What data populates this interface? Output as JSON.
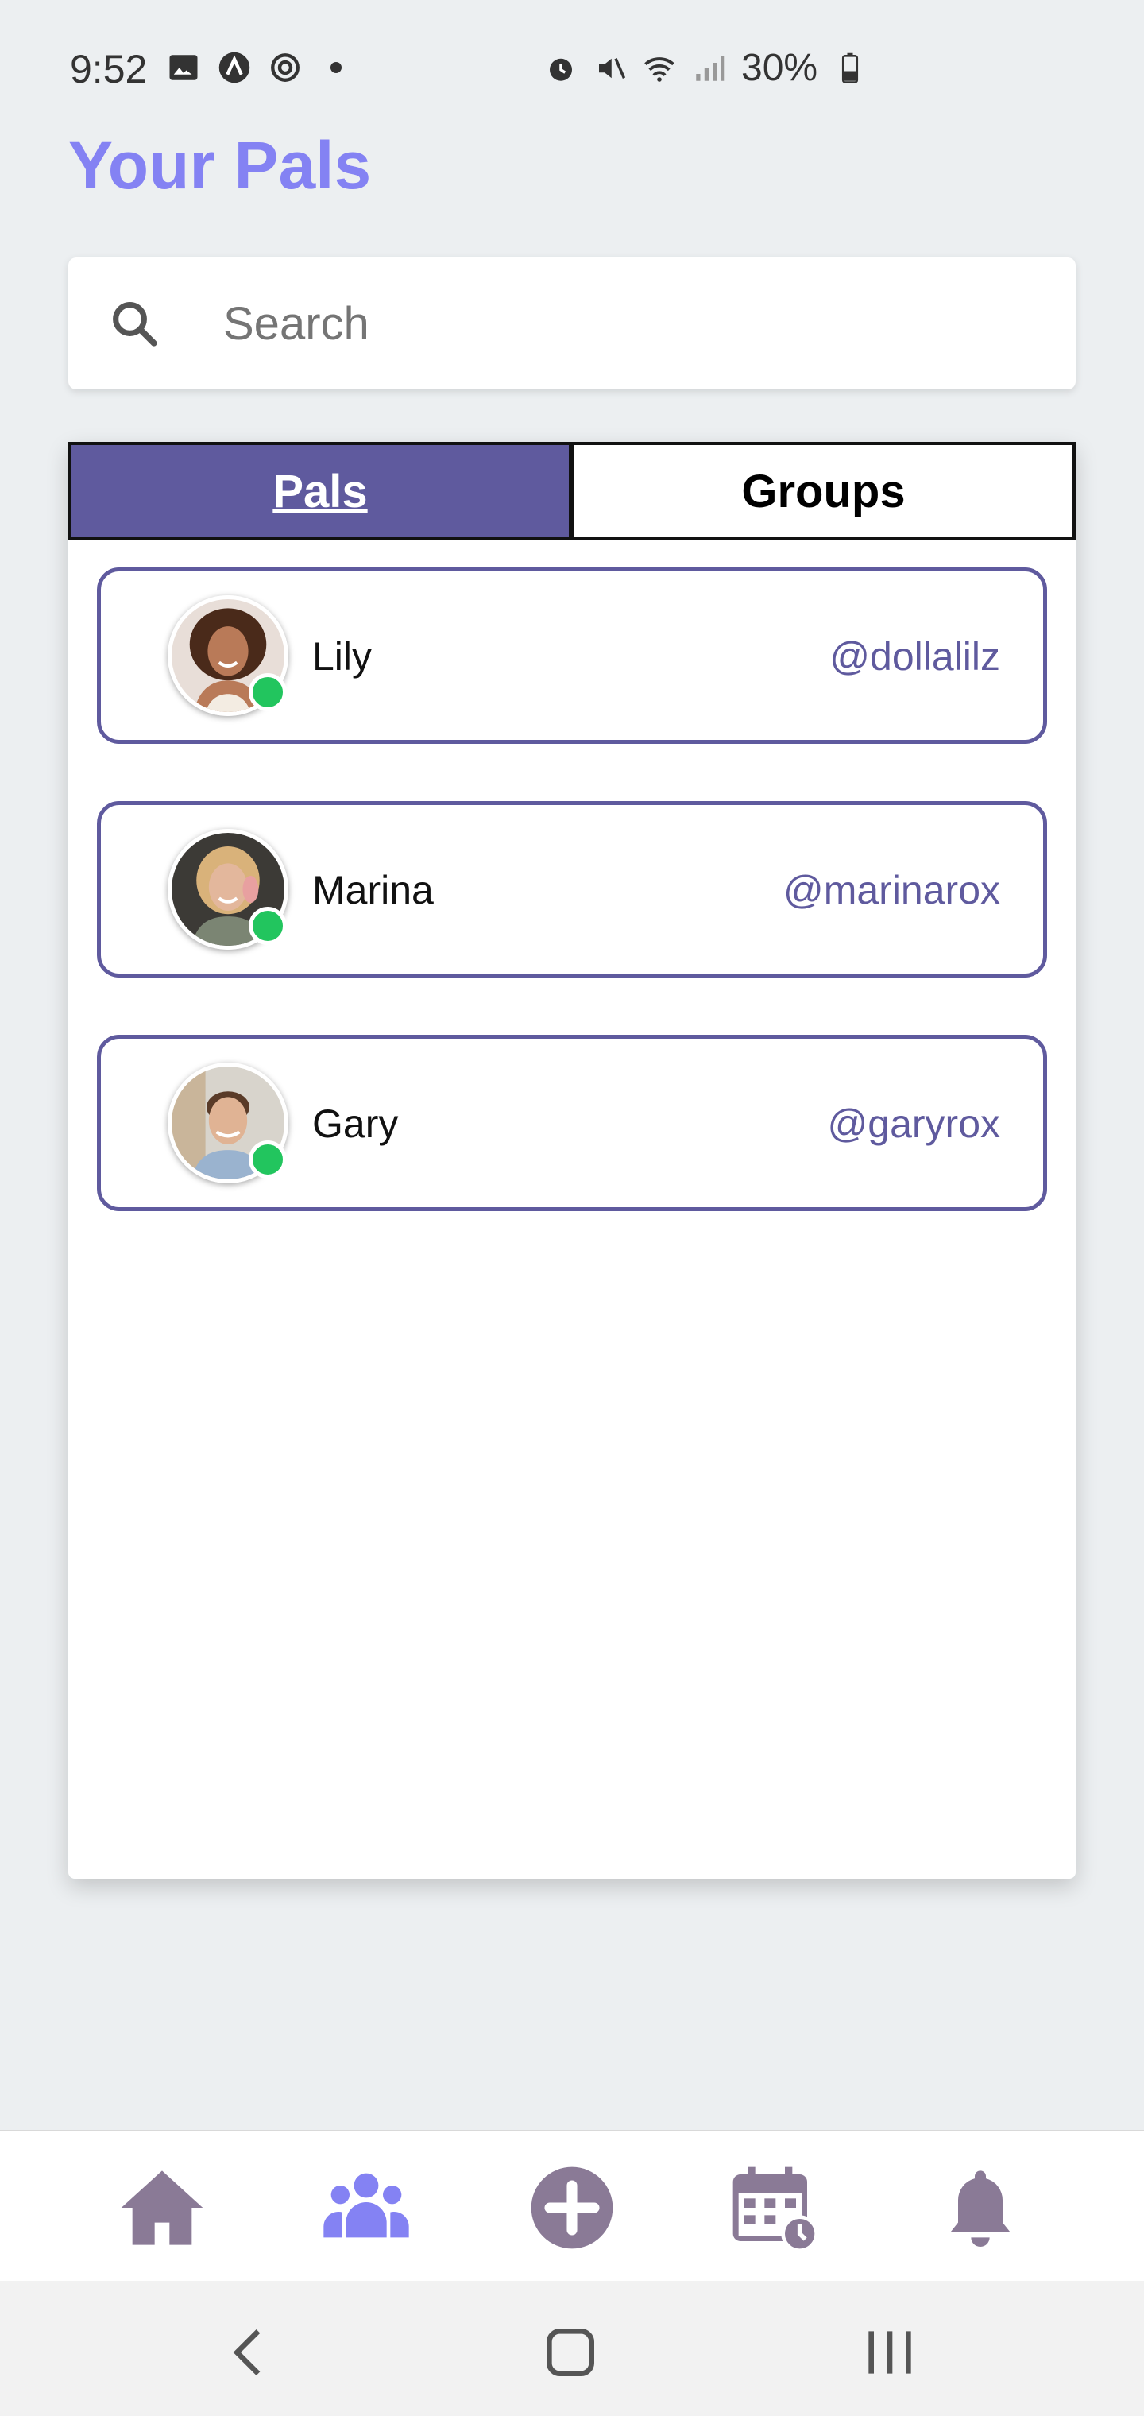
{
  "status_bar": {
    "time": "9:52",
    "battery": "30%"
  },
  "header": {
    "title": "Your Pals"
  },
  "search": {
    "placeholder": "Search",
    "value": ""
  },
  "tabs": [
    {
      "label": "Pals",
      "active": true
    },
    {
      "label": "Groups",
      "active": false
    }
  ],
  "pals": [
    {
      "name": "Lily",
      "handle": "@dollalilz",
      "online": true
    },
    {
      "name": "Marina",
      "handle": "@marinarox",
      "online": true
    },
    {
      "name": "Gary",
      "handle": "@garyrox",
      "online": true
    }
  ],
  "bottom_nav": [
    {
      "icon": "home-icon",
      "active": false
    },
    {
      "icon": "pals-icon",
      "active": true
    },
    {
      "icon": "add-icon",
      "active": false
    },
    {
      "icon": "calendar-icon",
      "active": false
    },
    {
      "icon": "bell-icon",
      "active": false
    }
  ],
  "colors": {
    "accent": "#8482f3",
    "primary": "#5f5a9e",
    "nav_icon": "#8a7a96",
    "online": "#22c55e"
  }
}
